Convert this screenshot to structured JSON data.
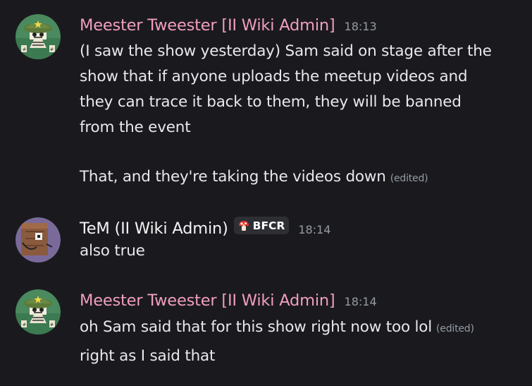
{
  "colors": {
    "background": "#1a1a1e",
    "admin_pink": "#f19ebd",
    "username_white": "#f2f3f5",
    "muted": "#949ba4",
    "tag_bg": "#2e2f35"
  },
  "messages": [
    {
      "author": "Meester Tweester [II Wiki Admin]",
      "timestamp": "18:13",
      "avatar_icon": "army-helmet-avatar-icon",
      "lines": [
        "(I saw the show yesterday) Sam said on stage after the",
        "show that if anyone uploads the meetup videos and",
        "they can trace it back to them, they will be banned",
        "from the event"
      ],
      "second_paragraph": "That, and they're taking the videos down",
      "edited_label": "(edited)"
    },
    {
      "author": "TeM (II Wiki Admin)",
      "timestamp": "18:14",
      "avatar_icon": "brown-block-avatar-icon",
      "tag": {
        "icon": "mushroom-icon",
        "label": "BFCR"
      },
      "lines": [
        "also true"
      ]
    },
    {
      "author": "Meester Tweester [II Wiki Admin]",
      "timestamp": "18:14",
      "avatar_icon": "army-helmet-avatar-icon",
      "line1": "oh Sam said that for this show right now too lol",
      "edited_label": "(edited)",
      "line2": "right as I said that"
    }
  ]
}
